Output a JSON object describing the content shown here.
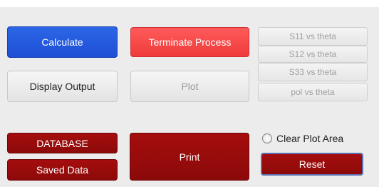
{
  "buttons": {
    "calculate": "Calculate",
    "terminate": "Terminate Process",
    "display_output": "Display Output",
    "plot": "Plot",
    "database": "DATABASE",
    "saved_data": "Saved Data",
    "print": "Print",
    "reset": "Reset"
  },
  "plot_options": [
    "S11 vs theta",
    "S12 vs theta",
    "S33 vs theta",
    "pol vs theta"
  ],
  "clear_plot": {
    "label": "Clear Plot Area",
    "checked": false
  },
  "colors": {
    "blue": "#1f4fd6",
    "red": "#ef3b3b",
    "dark_red": "#8c0a0a",
    "panel": "#ececec"
  }
}
